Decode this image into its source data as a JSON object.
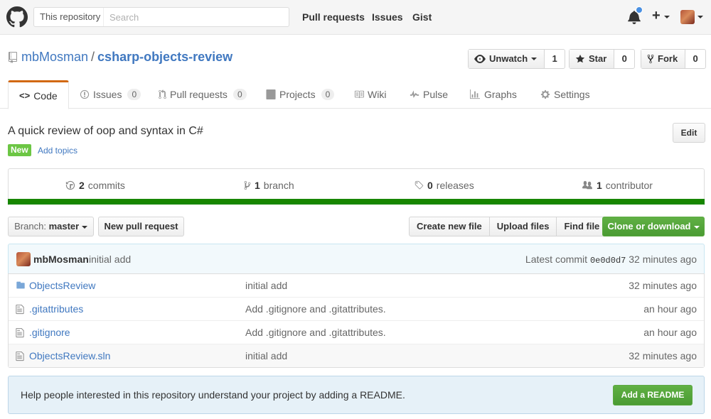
{
  "header": {
    "search_scope": "This repository",
    "search_placeholder": "Search",
    "nav": [
      "Pull requests",
      "Issues",
      "Gist"
    ],
    "plus_label": "+"
  },
  "repo": {
    "owner": "mbMosman",
    "separator": "/",
    "name": "csharp-objects-review",
    "watch": {
      "label": "Unwatch",
      "count": "1"
    },
    "star": {
      "label": "Star",
      "count": "0"
    },
    "fork": {
      "label": "Fork",
      "count": "0"
    }
  },
  "tabs": [
    {
      "label": "Code"
    },
    {
      "label": "Issues",
      "count": "0"
    },
    {
      "label": "Pull requests",
      "count": "0"
    },
    {
      "label": "Projects",
      "count": "0"
    },
    {
      "label": "Wiki"
    },
    {
      "label": "Pulse"
    },
    {
      "label": "Graphs"
    },
    {
      "label": "Settings"
    }
  ],
  "description": {
    "text": "A quick review of oop and syntax in C#",
    "new_badge": "New",
    "add_topics": "Add topics",
    "edit_label": "Edit"
  },
  "summary": {
    "commits": {
      "count": "2",
      "label": "commits"
    },
    "branch": {
      "count": "1",
      "label": "branch"
    },
    "releases": {
      "count": "0",
      "label": "releases"
    },
    "contributors": {
      "count": "1",
      "label": "contributor"
    },
    "language_color": "#178600"
  },
  "toolbar": {
    "branch_prefix": "Branch:",
    "branch_name": "master",
    "new_pr": "New pull request",
    "create_file": "Create new file",
    "upload_files": "Upload files",
    "find_file": "Find file",
    "clone": "Clone or download"
  },
  "commit_tease": {
    "author": "mbMosman",
    "message": "initial add",
    "latest_label": "Latest commit",
    "sha": "0e0d0d7",
    "age": "32 minutes ago"
  },
  "files": [
    {
      "name": "ObjectsReview",
      "type": "folder",
      "message": "initial add",
      "age": "32 minutes ago"
    },
    {
      "name": ".gitattributes",
      "type": "file",
      "message": "Add .gitignore and .gitattributes.",
      "age": "an hour ago"
    },
    {
      "name": ".gitignore",
      "type": "file",
      "message": "Add .gitignore and .gitattributes.",
      "age": "an hour ago"
    },
    {
      "name": "ObjectsReview.sln",
      "type": "file",
      "message": "initial add",
      "age": "32 minutes ago"
    }
  ],
  "readme_prompt": {
    "text": "Help people interested in this repository understand your project by adding a README.",
    "button": "Add a README"
  },
  "colors": {
    "link": "#4078c0",
    "tab_accent": "#d26911",
    "green": "#6cc644"
  }
}
